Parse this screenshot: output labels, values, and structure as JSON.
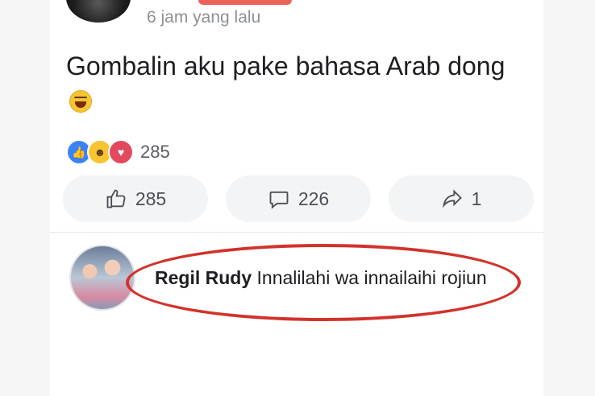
{
  "post": {
    "timestamp": "6 jam yang lalu",
    "text": "Gombalin aku pake bahasa Arab dong",
    "emoji_icon": "laughing-emoji",
    "reaction_icons": [
      "like-reaction-icon",
      "haha-reaction-icon",
      "love-reaction-icon"
    ],
    "reaction_count": "285"
  },
  "actions": {
    "like_count": "285",
    "comment_count": "226",
    "share_count": "1"
  },
  "comment": {
    "author": "Regil Rudy",
    "text": "Innalilahi wa innailaihi rojiun"
  },
  "colors": {
    "highlight_oval": "#d2322a",
    "like_blue": "#3b82f6",
    "love_red": "#e2495f",
    "haha_yellow": "#f7c531"
  }
}
